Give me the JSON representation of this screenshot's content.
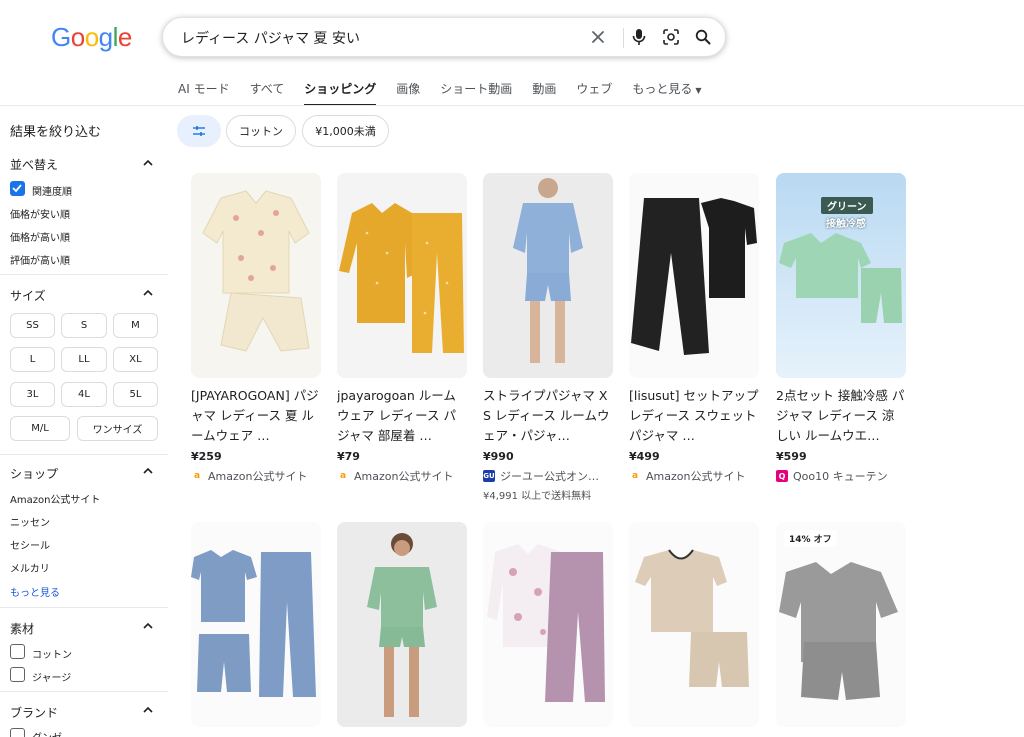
{
  "logo": {
    "letters": [
      "G",
      "o",
      "o",
      "g",
      "l",
      "e"
    ]
  },
  "search": {
    "query": "レディース パジャマ 夏 安い"
  },
  "tabs": [
    {
      "label": "AI モード",
      "active": false
    },
    {
      "label": "すべて",
      "active": false
    },
    {
      "label": "ショッピング",
      "active": true
    },
    {
      "label": "画像",
      "active": false
    },
    {
      "label": "ショート動画",
      "active": false
    },
    {
      "label": "動画",
      "active": false
    },
    {
      "label": "ウェブ",
      "active": false
    },
    {
      "label": "もっと見る",
      "active": false
    }
  ],
  "chips": [
    "コットン",
    "¥1,000未満"
  ],
  "sidebar": {
    "title": "結果を絞り込む",
    "sort": {
      "heading": "並べ替え",
      "options": [
        "関連度順",
        "価格が安い順",
        "価格が高い順",
        "評価が高い順"
      ]
    },
    "size": {
      "heading": "サイズ",
      "options": [
        "SS",
        "S",
        "M",
        "L",
        "LL",
        "XL",
        "3L",
        "4L",
        "5L",
        "M/L",
        "ワンサイズ"
      ]
    },
    "shop": {
      "heading": "ショップ",
      "options": [
        "Amazon公式サイト",
        "ニッセン",
        "セシール",
        "メルカリ"
      ],
      "more": "もっと見る"
    },
    "material": {
      "heading": "素材",
      "options": [
        "コットン",
        "ジャージ"
      ]
    },
    "brand": {
      "heading": "ブランド",
      "options": [
        "グンゼ"
      ]
    }
  },
  "products": [
    {
      "title": "[JPAYAROGOAN] パジャマ レディース 夏 ルームウェア …",
      "price": "¥259",
      "seller": "Amazon公式サイト",
      "seller_icon": "amazon-icon"
    },
    {
      "title": "jpayarogoan ルームウェア レディース パジャマ 部屋着 …",
      "price": "¥79",
      "seller": "Amazon公式サイト",
      "seller_icon": "amazon-icon"
    },
    {
      "title": "ストライプパジャマ XS レディース ルームウェア・パジャ…",
      "price": "¥990",
      "seller": "ジーユー公式オン…",
      "seller_icon": "gu-icon",
      "shipping": "¥4,991 以上で送料無料"
    },
    {
      "title": "[lisusut] セットアップ レディース スウェット パジャマ …",
      "price": "¥499",
      "seller": "Amazon公式サイト",
      "seller_icon": "amazon-icon"
    },
    {
      "title": "2点セット 接触冷感 パジャマ レディース 涼しい ルームウエ…",
      "price": "¥599",
      "seller": "Qoo10 キューテン",
      "seller_icon": "qoo10-icon",
      "image_text": [
        "グリーン",
        "接触冷感"
      ]
    }
  ],
  "second_row": {
    "badge": "14% オフ"
  },
  "colors": {
    "accent": "#1a73e8",
    "link": "#1558d6"
  }
}
